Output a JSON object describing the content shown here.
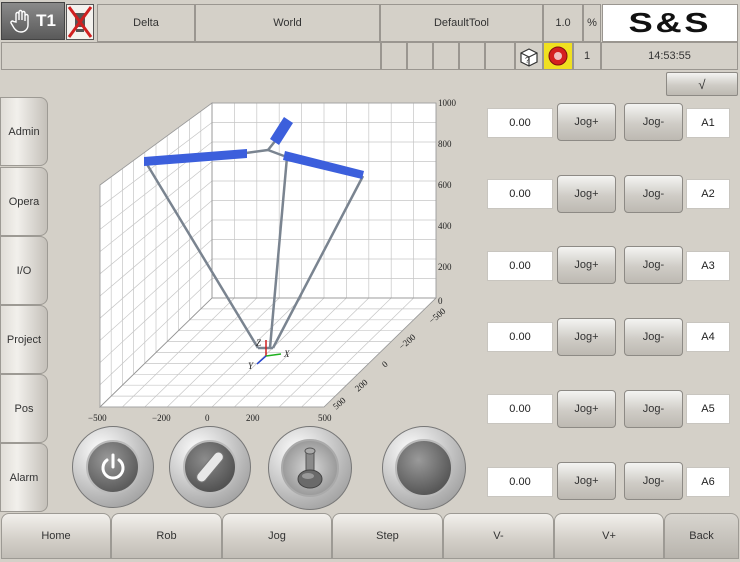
{
  "header": {
    "mode": "T1",
    "robot": "Delta",
    "frame": "World",
    "tool": "DefaultTool",
    "speed": "1.0",
    "speed_unit": "%",
    "brand": "S&S",
    "task_number": "1",
    "clock": "14:53:55",
    "confirm": "√"
  },
  "icons": {
    "mode": "hand-icon",
    "status": "alarm-off-icon",
    "cube": "cube-icon",
    "estop": "emergency-stop-icon"
  },
  "sidebar": {
    "items": [
      {
        "label": "Admin"
      },
      {
        "label": "Opera"
      },
      {
        "label": "I/O"
      },
      {
        "label": "Project"
      },
      {
        "label": "Pos"
      },
      {
        "label": "Alarm"
      }
    ]
  },
  "axes": [
    {
      "value": "0.00",
      "plus": "Jog+",
      "minus": "Jog-",
      "name": "A1"
    },
    {
      "value": "0.00",
      "plus": "Jog+",
      "minus": "Jog-",
      "name": "A2"
    },
    {
      "value": "0.00",
      "plus": "Jog+",
      "minus": "Jog-",
      "name": "A3"
    },
    {
      "value": "0.00",
      "plus": "Jog+",
      "minus": "Jog-",
      "name": "A4"
    },
    {
      "value": "0.00",
      "plus": "Jog+",
      "minus": "Jog-",
      "name": "A5"
    },
    {
      "value": "0.00",
      "plus": "Jog+",
      "minus": "Jog-",
      "name": "A6"
    }
  ],
  "view3d": {
    "z_ticks": [
      "1000",
      "800",
      "600",
      "400",
      "200",
      "0"
    ],
    "x_ticks": [
      "−500",
      "−200",
      "0",
      "200",
      "500"
    ],
    "y_ticks": [
      "−500",
      "−200",
      "0",
      "200",
      "500"
    ],
    "frame_labels": {
      "x": "X",
      "y": "Y",
      "z": "Z"
    }
  },
  "bottom": {
    "items": [
      {
        "label": "Home"
      },
      {
        "label": "Rob"
      },
      {
        "label": "Jog"
      },
      {
        "label": "Step"
      },
      {
        "label": "V-"
      },
      {
        "label": "V+"
      },
      {
        "label": "Back"
      }
    ]
  },
  "colors": {
    "background": "#d4d0c8",
    "robot_arm": "#3c5fdc",
    "robot_link": "#7a8490",
    "estop": "#d42020",
    "estop_bg": "#f0e020"
  }
}
